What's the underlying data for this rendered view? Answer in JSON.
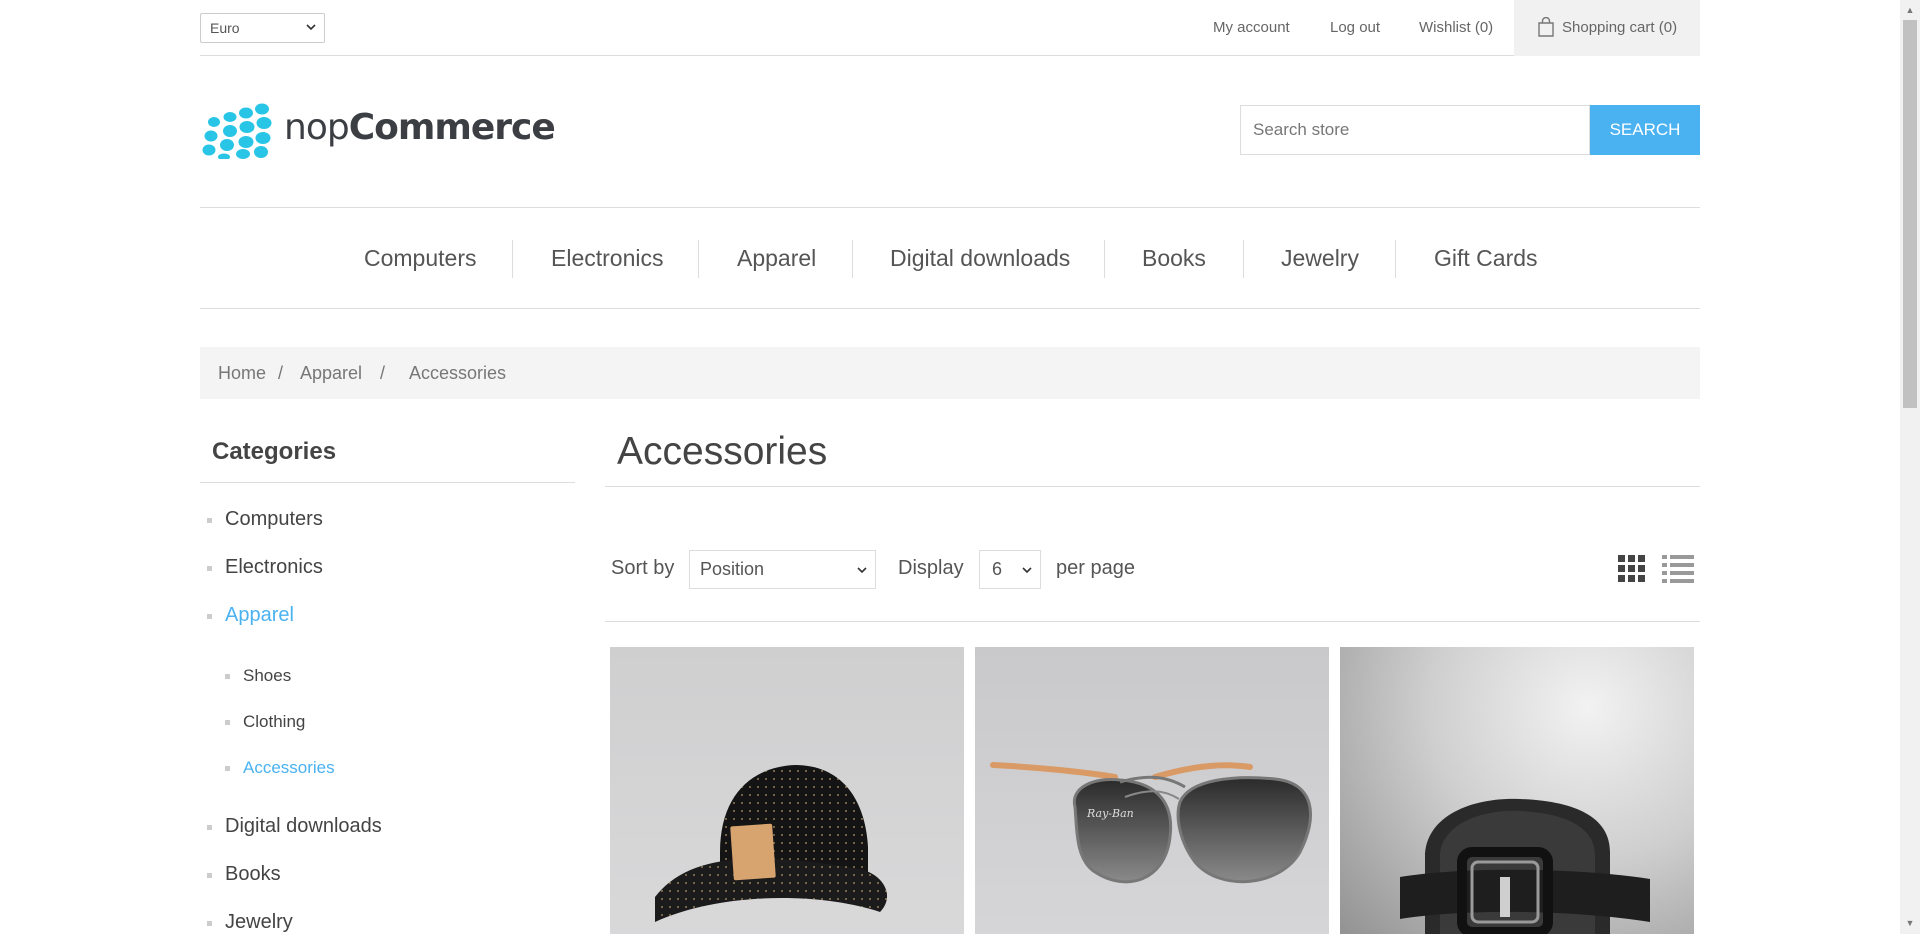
{
  "header": {
    "currency": "Euro",
    "links": [
      "My account",
      "Log out",
      "Wishlist (0)"
    ],
    "cart_label": "Shopping cart (0)"
  },
  "logo": {
    "text_light": "nop",
    "text_bold": "Commerce"
  },
  "search": {
    "placeholder": "Search store",
    "button_label": "SEARCH"
  },
  "top_menu": [
    "Computers",
    "Electronics",
    "Apparel",
    "Digital downloads",
    "Books",
    "Jewelry",
    "Gift Cards"
  ],
  "breadcrumb": {
    "items": [
      "Home",
      "Apparel",
      "Accessories"
    ],
    "separator": "/"
  },
  "sidebar": {
    "title": "Categories",
    "categories": [
      {
        "label": "Computers"
      },
      {
        "label": "Electronics"
      },
      {
        "label": "Apparel",
        "active": true
      },
      {
        "label": "Shoes",
        "sub": true
      },
      {
        "label": "Clothing",
        "sub": true
      },
      {
        "label": "Accessories",
        "sub": true,
        "active": true
      },
      {
        "label": "Digital downloads"
      },
      {
        "label": "Books"
      },
      {
        "label": "Jewelry"
      }
    ]
  },
  "main": {
    "title": "Accessories",
    "sort_label": "Sort by",
    "sort_value": "Position",
    "display_label": "Display",
    "display_value": "6",
    "per_page_label": "per page",
    "view_modes": [
      "grid-icon",
      "list-icon"
    ],
    "products": [
      {
        "image": "cap-image"
      },
      {
        "image": "sunglasses-image"
      },
      {
        "image": "belt-image"
      }
    ]
  },
  "colors": {
    "accent": "#4ab2f1",
    "logo_dots": "#29c5e6",
    "text": "#444444"
  }
}
